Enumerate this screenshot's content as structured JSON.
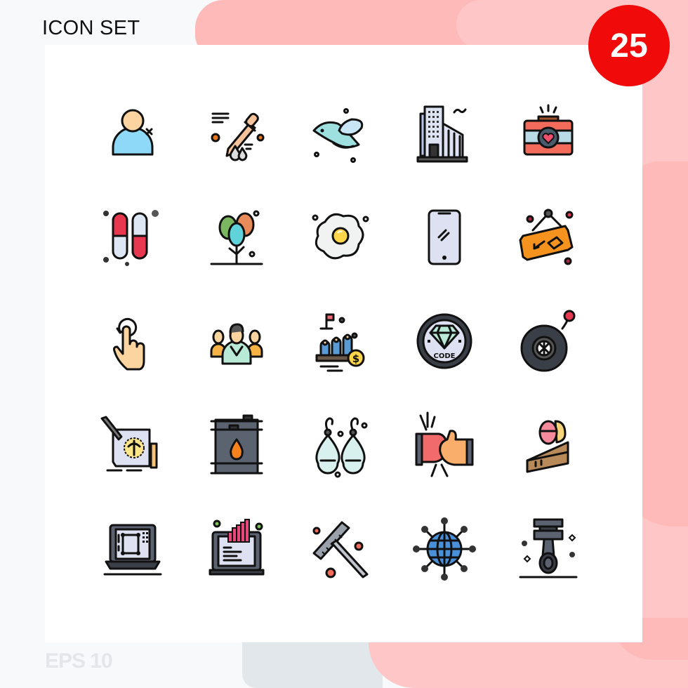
{
  "header": {
    "title": "ICON SET",
    "count_badge": "25"
  },
  "footer": {
    "format_label": "EPS 10"
  },
  "colors": {
    "badge_red": "#f00a0a",
    "bg_pink": "#fdbab9",
    "bg_pink_light": "#fec6c6",
    "bg_grey": "#e1e7ea",
    "panel": "#ffffff"
  },
  "icons": [
    {
      "row": 1,
      "col": 1,
      "name": "remove-user-icon"
    },
    {
      "row": 1,
      "col": 2,
      "name": "dropper-icon"
    },
    {
      "row": 1,
      "col": 3,
      "name": "bird-icon"
    },
    {
      "row": 1,
      "col": 4,
      "name": "office-building-icon"
    },
    {
      "row": 1,
      "col": 5,
      "name": "camera-heart-icon"
    },
    {
      "row": 2,
      "col": 1,
      "name": "pills-capsule-icon"
    },
    {
      "row": 2,
      "col": 2,
      "name": "balloons-icon"
    },
    {
      "row": 2,
      "col": 3,
      "name": "fried-egg-icon"
    },
    {
      "row": 2,
      "col": 4,
      "name": "smartphone-icon"
    },
    {
      "row": 2,
      "col": 5,
      "name": "hanging-sign-icon"
    },
    {
      "row": 3,
      "col": 1,
      "name": "rotate-gesture-icon"
    },
    {
      "row": 3,
      "col": 2,
      "name": "team-leader-icon"
    },
    {
      "row": 3,
      "col": 3,
      "name": "podium-money-icon"
    },
    {
      "row": 3,
      "col": 4,
      "name": "diamond-code-icon",
      "label": "CODE"
    },
    {
      "row": 3,
      "col": 5,
      "name": "wheel-tire-icon"
    },
    {
      "row": 4,
      "col": 1,
      "name": "design-drawing-icon"
    },
    {
      "row": 4,
      "col": 2,
      "name": "oil-barrel-icon"
    },
    {
      "row": 4,
      "col": 3,
      "name": "earrings-icon"
    },
    {
      "row": 4,
      "col": 4,
      "name": "fist-bump-icon"
    },
    {
      "row": 4,
      "col": 5,
      "name": "easter-cake-icon"
    },
    {
      "row": 5,
      "col": 1,
      "name": "laptop-design-icon"
    },
    {
      "row": 5,
      "col": 2,
      "name": "laptop-analytics-icon"
    },
    {
      "row": 5,
      "col": 3,
      "name": "rake-icon"
    },
    {
      "row": 5,
      "col": 4,
      "name": "global-network-icon"
    },
    {
      "row": 5,
      "col": 5,
      "name": "piston-icon"
    }
  ]
}
